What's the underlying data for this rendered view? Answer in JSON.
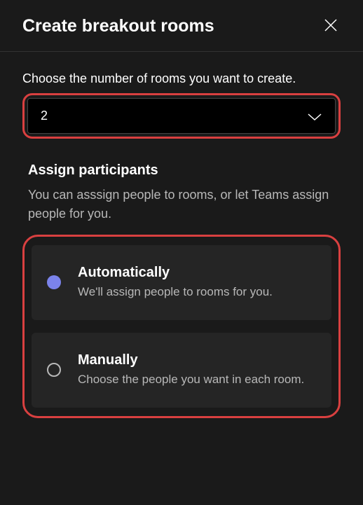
{
  "header": {
    "title": "Create breakout rooms"
  },
  "roomCount": {
    "instruction": "Choose the number of rooms you want to create.",
    "value": "2"
  },
  "assign": {
    "sectionTitle": "Assign participants",
    "sectionDesc": "You can asssign people to rooms, or let Teams assign people for you.",
    "options": {
      "automatic": {
        "title": "Automatically",
        "desc": "We'll assign people to rooms for you.",
        "selected": true
      },
      "manual": {
        "title": "Manually",
        "desc": "Choose the people you want in each room.",
        "selected": false
      }
    }
  }
}
